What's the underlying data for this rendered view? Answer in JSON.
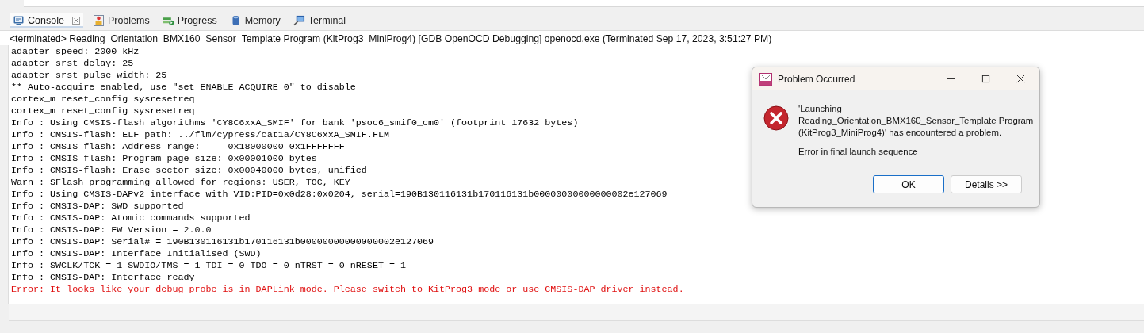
{
  "tabs": [
    {
      "label": "Console",
      "selected": true,
      "closable": true,
      "kind": "console"
    },
    {
      "label": "Problems",
      "selected": false,
      "closable": false,
      "kind": "problems"
    },
    {
      "label": "Progress",
      "selected": false,
      "closable": false,
      "kind": "progress"
    },
    {
      "label": "Memory",
      "selected": false,
      "closable": false,
      "kind": "memory"
    },
    {
      "label": "Terminal",
      "selected": false,
      "closable": false,
      "kind": "terminal"
    }
  ],
  "console": {
    "header": "<terminated> Reading_Orientation_BMX160_Sensor_Template Program (KitProg3_MiniProg4) [GDB OpenOCD Debugging] openocd.exe (Terminated Sep 17, 2023, 3:51:27 PM)",
    "lines": [
      {
        "kind": "info",
        "text": "adapter speed: 2000 kHz"
      },
      {
        "kind": "info",
        "text": "adapter srst delay: 25"
      },
      {
        "kind": "info",
        "text": "adapter srst pulse_width: 25"
      },
      {
        "kind": "info",
        "text": "** Auto-acquire enabled, use \"set ENABLE_ACQUIRE 0\" to disable"
      },
      {
        "kind": "info",
        "text": "cortex_m reset_config sysresetreq"
      },
      {
        "kind": "info",
        "text": "cortex_m reset_config sysresetreq"
      },
      {
        "kind": "info",
        "text": "Info : Using CMSIS-flash algorithms 'CY8C6xxA_SMIF' for bank 'psoc6_smif0_cm0' (footprint 17632 bytes)"
      },
      {
        "kind": "info",
        "text": "Info : CMSIS-flash: ELF path: ../flm/cypress/cat1a/CY8C6xxA_SMIF.FLM"
      },
      {
        "kind": "info",
        "text": "Info : CMSIS-flash: Address range:     0x18000000-0x1FFFFFFF"
      },
      {
        "kind": "info",
        "text": "Info : CMSIS-flash: Program page size: 0x00001000 bytes"
      },
      {
        "kind": "info",
        "text": "Info : CMSIS-flash: Erase sector size: 0x00040000 bytes, unified"
      },
      {
        "kind": "info",
        "text": "Warn : SFlash programming allowed for regions: USER, TOC, KEY"
      },
      {
        "kind": "info",
        "text": "Info : Using CMSIS-DAPv2 interface with VID:PID=0x0d28:0x0204, serial=190B130116131b170116131b00000000000000002e127069"
      },
      {
        "kind": "info",
        "text": "Info : CMSIS-DAP: SWD supported"
      },
      {
        "kind": "info",
        "text": "Info : CMSIS-DAP: Atomic commands supported"
      },
      {
        "kind": "info",
        "text": "Info : CMSIS-DAP: FW Version = 2.0.0"
      },
      {
        "kind": "info",
        "text": "Info : CMSIS-DAP: Serial# = 190B130116131b170116131b00000000000000002e127069"
      },
      {
        "kind": "info",
        "text": "Info : CMSIS-DAP: Interface Initialised (SWD)"
      },
      {
        "kind": "info",
        "text": "Info : SWCLK/TCK = 1 SWDIO/TMS = 1 TDI = 0 TDO = 0 nTRST = 0 nRESET = 1"
      },
      {
        "kind": "info",
        "text": "Info : CMSIS-DAP: Interface ready"
      },
      {
        "kind": "error",
        "text": "Error: It looks like your debug probe is in DAPLink mode. Please switch to KitProg3 mode or use CMSIS-DAP driver instead."
      }
    ]
  },
  "dialog": {
    "title": "Problem Occurred",
    "message": "'Launching Reading_Orientation_BMX160_Sensor_Template Program (KitProg3_MiniProg4)' has encountered a problem.",
    "detail": "Error in final launch sequence",
    "buttons": [
      {
        "label": "OK",
        "selected": true
      },
      {
        "label": "Details >>",
        "selected": false
      }
    ]
  }
}
